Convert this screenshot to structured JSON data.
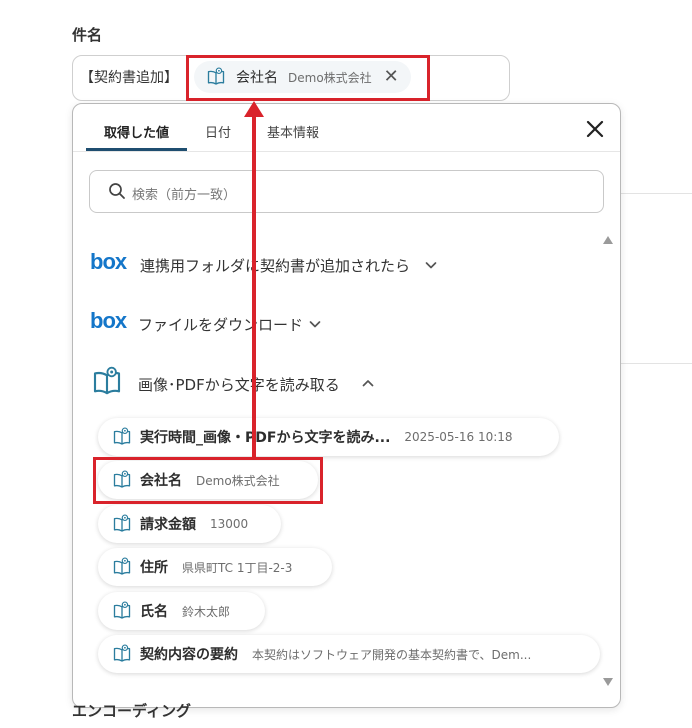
{
  "field": {
    "label": "件名",
    "prefix": "【契約書追加】",
    "chip_name": "会社名",
    "chip_value": "Demo株式会社"
  },
  "tabs": [
    {
      "label": "取得した値"
    },
    {
      "label": "日付"
    },
    {
      "label": "基本情報"
    }
  ],
  "search": {
    "placeholder": "検索（前方一致）"
  },
  "sections": [
    {
      "label": "連携用フォルダに契約書が追加されたら",
      "logo": "box"
    },
    {
      "label": "ファイルをダウンロード",
      "logo": "box"
    },
    {
      "label": "画像･PDFから文字を読み取る"
    }
  ],
  "items": [
    {
      "name": "実行時間_画像・PDFから文字を読み...",
      "value": "2025-05-16 10:18"
    },
    {
      "name": "会社名",
      "value": "Demo株式会社"
    },
    {
      "name": "請求金額",
      "value": "13000"
    },
    {
      "name": "住所",
      "value": "県県町TC 1丁目-2-3"
    },
    {
      "name": "氏名",
      "value": "鈴木太郎"
    },
    {
      "name": "契約内容の要約",
      "value": "本契約はソフトウェア開発の基本契約書で、Dem..."
    }
  ],
  "next_field": {
    "label": "エンコーディング"
  },
  "colors": {
    "accent": "#1f4e70",
    "highlight": "#d9232b",
    "box": "#1476c9"
  },
  "icons": {
    "ocr": "book-scan-icon",
    "close": "close-icon",
    "search": "search-icon",
    "expand": "chevron-down-icon",
    "collapse": "chevron-up-icon"
  }
}
